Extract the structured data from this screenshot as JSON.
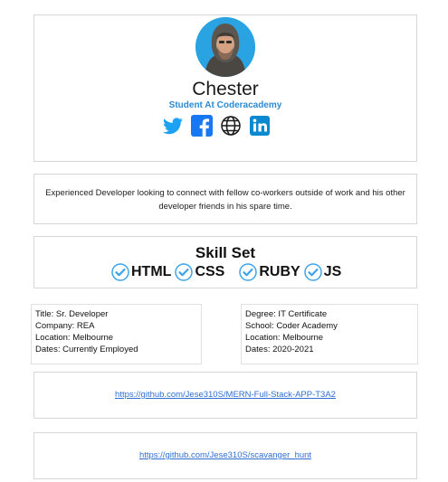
{
  "profile": {
    "name": "Chester",
    "role": "Student At Coderacademy",
    "socials": [
      "twitter-icon",
      "facebook-icon",
      "globe-icon",
      "linkedin-icon"
    ],
    "colors": {
      "accent": "#2d8ad2",
      "twitter": "#1da1f2",
      "facebook": "#1877f2",
      "linkedin": "#0a89d0"
    }
  },
  "bio": {
    "text": "Experienced Developer looking to connect with fellow co-workers outside of work and his other developer friends in his spare time."
  },
  "skills": {
    "title": "Skill Set",
    "items": [
      "HTML",
      "CSS",
      "RUBY",
      "JS"
    ]
  },
  "work": {
    "title": "Title: Sr. Developer",
    "company": "Company: REA",
    "location": "Location: Melbourne",
    "dates": "Dates: Currently Employed"
  },
  "education": {
    "degree": "Degree: IT Certificate",
    "school": "School: Coder Academy",
    "location": "Location: Melbourne",
    "dates": "Dates: 2020-2021"
  },
  "repos": [
    {
      "url": "https://github.com/Jese310S/MERN-Full-Stack-APP-T3A2"
    },
    {
      "url": "https://github.com/Jese310S/scavanger_hunt"
    }
  ]
}
